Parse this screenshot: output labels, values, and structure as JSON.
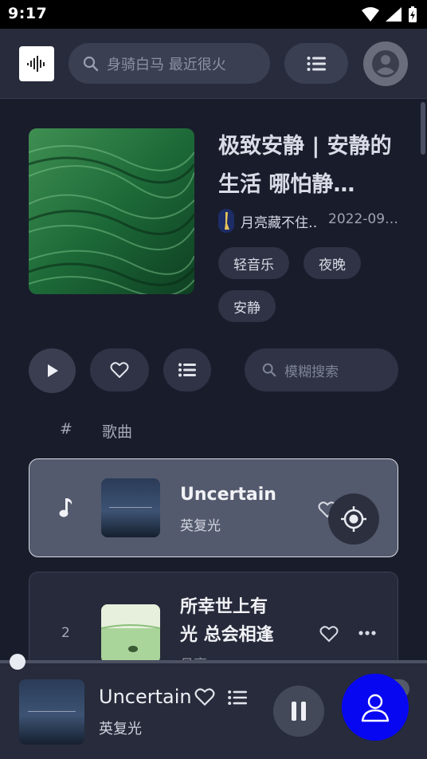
{
  "status_bar": {
    "time": "9:17"
  },
  "header": {
    "search_placeholder": "身骑白马 最近很火"
  },
  "playlist": {
    "title": "极致安静 | 安静的生活 哪怕静…",
    "creator": "月亮藏不住…",
    "date": "2022-09…",
    "tags": [
      "轻音乐",
      "夜晚",
      "安静"
    ]
  },
  "actions": {
    "filter_placeholder": "模糊搜索"
  },
  "list_header": {
    "num": "#",
    "song": "歌曲"
  },
  "songs": [
    {
      "index": "",
      "title": "Uncertain",
      "artist": "英复光",
      "playing": true
    },
    {
      "index": "2",
      "title": "所幸世上有光 总会相逢",
      "artist": "月亮"
    }
  ],
  "player": {
    "title": "Uncertain",
    "artist": "英复光",
    "progress": 0.02
  },
  "colors": {
    "accent_fab": "#0707f2",
    "background": "#191c2b",
    "header": "#272b3b"
  },
  "icons": [
    "logo-waveform-icon",
    "search-icon",
    "list-icon",
    "account-icon",
    "play-icon",
    "heart-icon",
    "music-note-icon",
    "locate-icon",
    "more-icon",
    "pause-icon",
    "user-icon"
  ]
}
